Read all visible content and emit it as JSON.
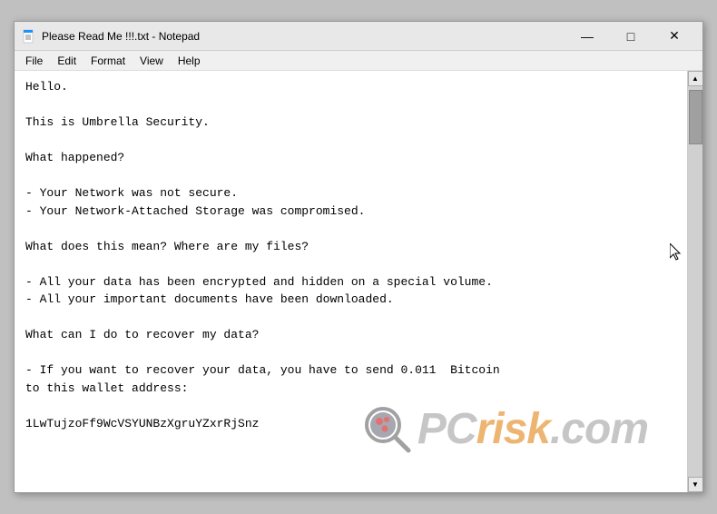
{
  "window": {
    "title": "Please Read Me !!!.txt - Notepad",
    "icon": "notepad"
  },
  "titlebar": {
    "minimize_label": "—",
    "maximize_label": "□",
    "close_label": "✕"
  },
  "menu": {
    "items": [
      "File",
      "Edit",
      "Format",
      "View",
      "Help"
    ]
  },
  "content": {
    "text": "Hello.\n\nThis is Umbrella Security.\n\nWhat happened?\n\n- Your Network was not secure.\n- Your Network-Attached Storage was compromised.\n\nWhat does this mean? Where are my files?\n\n- All your data has been encrypted and hidden on a special volume.\n- All your important documents have been downloaded.\n\nWhat can I do to recover my data?\n\n- If you want to recover your data, you have to send 0.011  Bitcoin\nto this wallet address:\n\n1LwTujzoFf9WcVSYUNBzXgruYZxrRjSnz"
  },
  "watermark": {
    "pc": "PC",
    "risk": "risk",
    "com": ".com"
  }
}
